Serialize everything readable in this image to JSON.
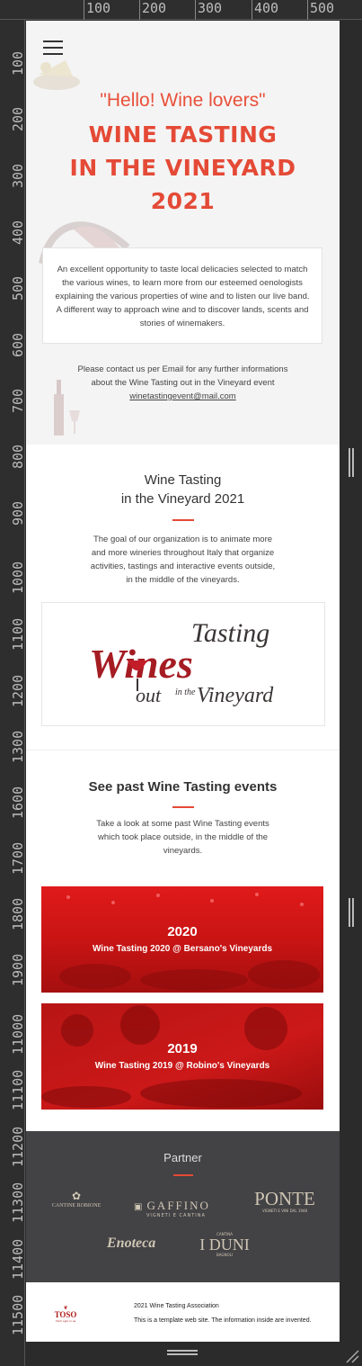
{
  "viewer": {
    "ruler_top_labels": [
      "100",
      "200",
      "300",
      "400",
      "500"
    ],
    "ruler_left_labels": [
      "100",
      "200",
      "300",
      "400",
      "500",
      "600",
      "700",
      "800",
      "900",
      "1000",
      "1100",
      "1200",
      "1300",
      "1600",
      "1700",
      "1800",
      "1900",
      "11000",
      "11100",
      "11200",
      "11300",
      "11400",
      "11500"
    ]
  },
  "hero": {
    "intro": "\"Hello! Wine lovers\"",
    "title_lines": [
      "WINE TASTING",
      "IN THE VINEYARD",
      "2021"
    ],
    "description": "An excellent opportunity to taste local delicacies selected to match the various wines, to learn more from our esteemed oenologists explaining the various properties of wine and to listen our live band. A different way to approach wine and to discover lands, scents and stories of winemakers.",
    "contact_line1": "Please contact us per Email for any further informations",
    "contact_line2": "about the Wine Tasting out in the Vineyard event",
    "email": "winetastingevent@mail.com"
  },
  "about": {
    "title_line1": "Wine Tasting",
    "title_line2": "in the Vineyard 2021",
    "text_lines": [
      "The goal of our organization is to animate more",
      "and more wineries throughout Italy that organize",
      "activities, tastings and interactive events outside,",
      "in the middle of the vineyards."
    ],
    "logo": {
      "tasting": "Tasting",
      "wines": "Wines",
      "out": "out",
      "in_the": "in the",
      "vineyard": "Vineyard"
    }
  },
  "past": {
    "title": "See past Wine Tasting events",
    "text_lines": [
      "Take a look at some past Wine Tasting events",
      "which took place outside, in the middle of the",
      "vineyards."
    ],
    "events": [
      {
        "year": "2020",
        "name": "Wine Tasting 2020 @ Bersano's Vineyards"
      },
      {
        "year": "2019",
        "name": "Wine Tasting 2019 @ Robino's Vineyards"
      }
    ]
  },
  "partners": {
    "title": "Partner",
    "logos": {
      "robione": "CANTINE ROBIONE",
      "gaffino": "GAFFINO",
      "gaffino_sub": "VIGNETI E CANTINA",
      "ponte": "PONTE",
      "ponte_sub": "VIGNETI E VINI DAL 1948",
      "enoteca": "Enoteca",
      "duni_top": "CANTINA",
      "duni": "I DUNI",
      "duni_sub": "BAGNOLI"
    }
  },
  "footer": {
    "logo_text": "TOSO",
    "logo_tagline": "Vivili ogni in sé",
    "line1": "2021 Wine Tasting Association",
    "line2": "This is a template web site. The information inside are invented."
  },
  "colors": {
    "accent": "#e44a36",
    "event_red": "#d01414",
    "partner_bg": "#434245"
  }
}
